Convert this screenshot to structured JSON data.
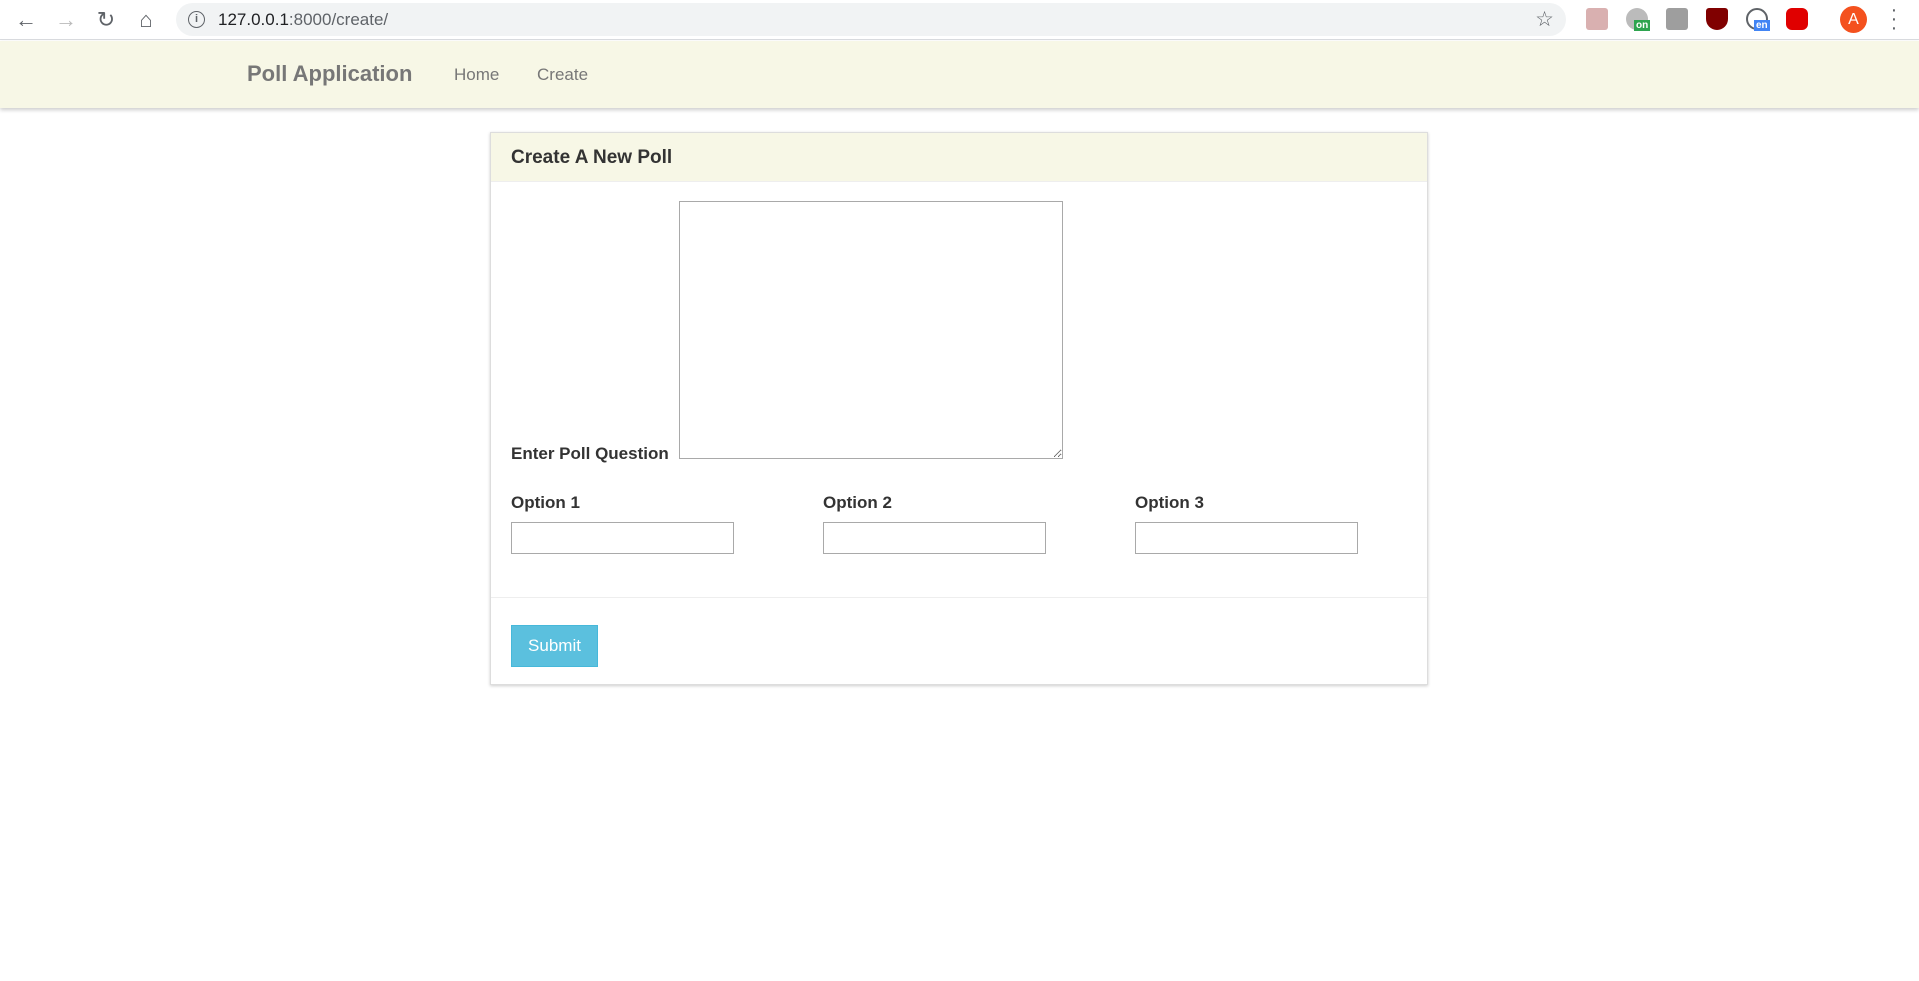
{
  "browser": {
    "url_host": "127.0.0.1",
    "url_rest": ":8000/create/",
    "avatar_letter": "A",
    "extensions": [
      {
        "name": "pdf-icon",
        "color": "#c8a0a0"
      },
      {
        "name": "timer-on-icon",
        "color": "#9e9e9e",
        "badge": "on",
        "badge_color": "#2ea44f"
      },
      {
        "name": "tb-icon",
        "color": "#9e9e9e"
      },
      {
        "name": "ublock-icon",
        "color": "#800000"
      },
      {
        "name": "translate-icon",
        "color": "#5f6368",
        "badge": "en",
        "badge_color": "#4285f4"
      },
      {
        "name": "adblock-icon",
        "color": "#e00000"
      }
    ]
  },
  "navbar": {
    "brand": "Poll Application",
    "links": [
      "Home",
      "Create"
    ]
  },
  "card": {
    "title": "Create A New Poll",
    "question_label": "Enter Poll Question",
    "question_value": "",
    "options": [
      {
        "label": "Option 1",
        "value": ""
      },
      {
        "label": "Option 2",
        "value": ""
      },
      {
        "label": "Option 3",
        "value": ""
      }
    ],
    "submit_label": "Submit"
  },
  "colors": {
    "navbar_bg": "#f7f7e6",
    "submit_bg": "#5bc0de"
  }
}
